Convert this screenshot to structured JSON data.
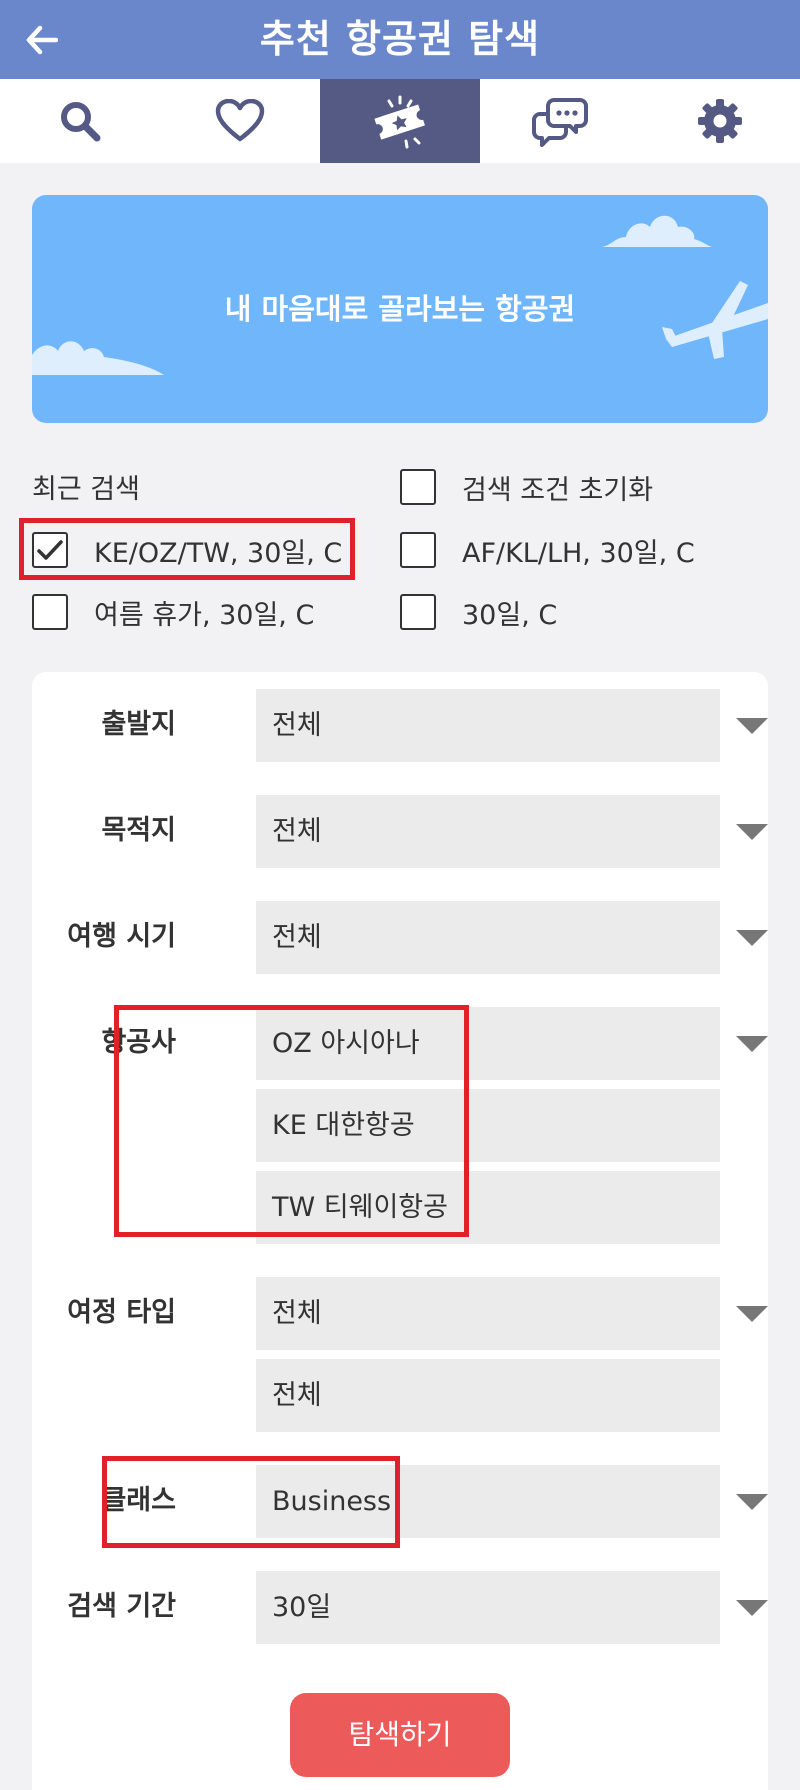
{
  "header": {
    "title": "추천 항공권 탐색"
  },
  "tabs": [
    {
      "icon": "search-icon"
    },
    {
      "icon": "heart-icon"
    },
    {
      "icon": "ticket-icon",
      "active": true
    },
    {
      "icon": "chat-icon"
    },
    {
      "icon": "gear-icon"
    }
  ],
  "banner": {
    "text": "내 마음대로 골라보는 항공권"
  },
  "recent": {
    "label": "최근 검색",
    "reset_label": "검색 조건 초기화",
    "items": [
      {
        "label": "KE/OZ/TW, 30일, C",
        "checked": true
      },
      {
        "label": "AF/KL/LH, 30일, C",
        "checked": false
      },
      {
        "label": "여름 휴가, 30일, C",
        "checked": false
      },
      {
        "label": "30일, C",
        "checked": false
      }
    ]
  },
  "form": {
    "departure": {
      "label": "출발지",
      "value": "전체"
    },
    "destination": {
      "label": "목적지",
      "value": "전체"
    },
    "period": {
      "label": "여행 시기",
      "value": "전체"
    },
    "airline": {
      "label": "항공사",
      "values": [
        "OZ 아시아나",
        "KE 대한항공",
        "TW 티웨이항공"
      ]
    },
    "trip_type": {
      "label": "여정 타입",
      "values": [
        "전체",
        "전체"
      ]
    },
    "class": {
      "label": "클래스",
      "value": "Business"
    },
    "search_period": {
      "label": "검색 기간",
      "value": "30일"
    }
  },
  "submit": {
    "label": "탐색하기"
  },
  "colors": {
    "header": "#6b87cc",
    "active_tab": "#555a85",
    "banner": "#6fb6fb",
    "button": "#ec5a5a",
    "highlight": "#e0202a"
  }
}
